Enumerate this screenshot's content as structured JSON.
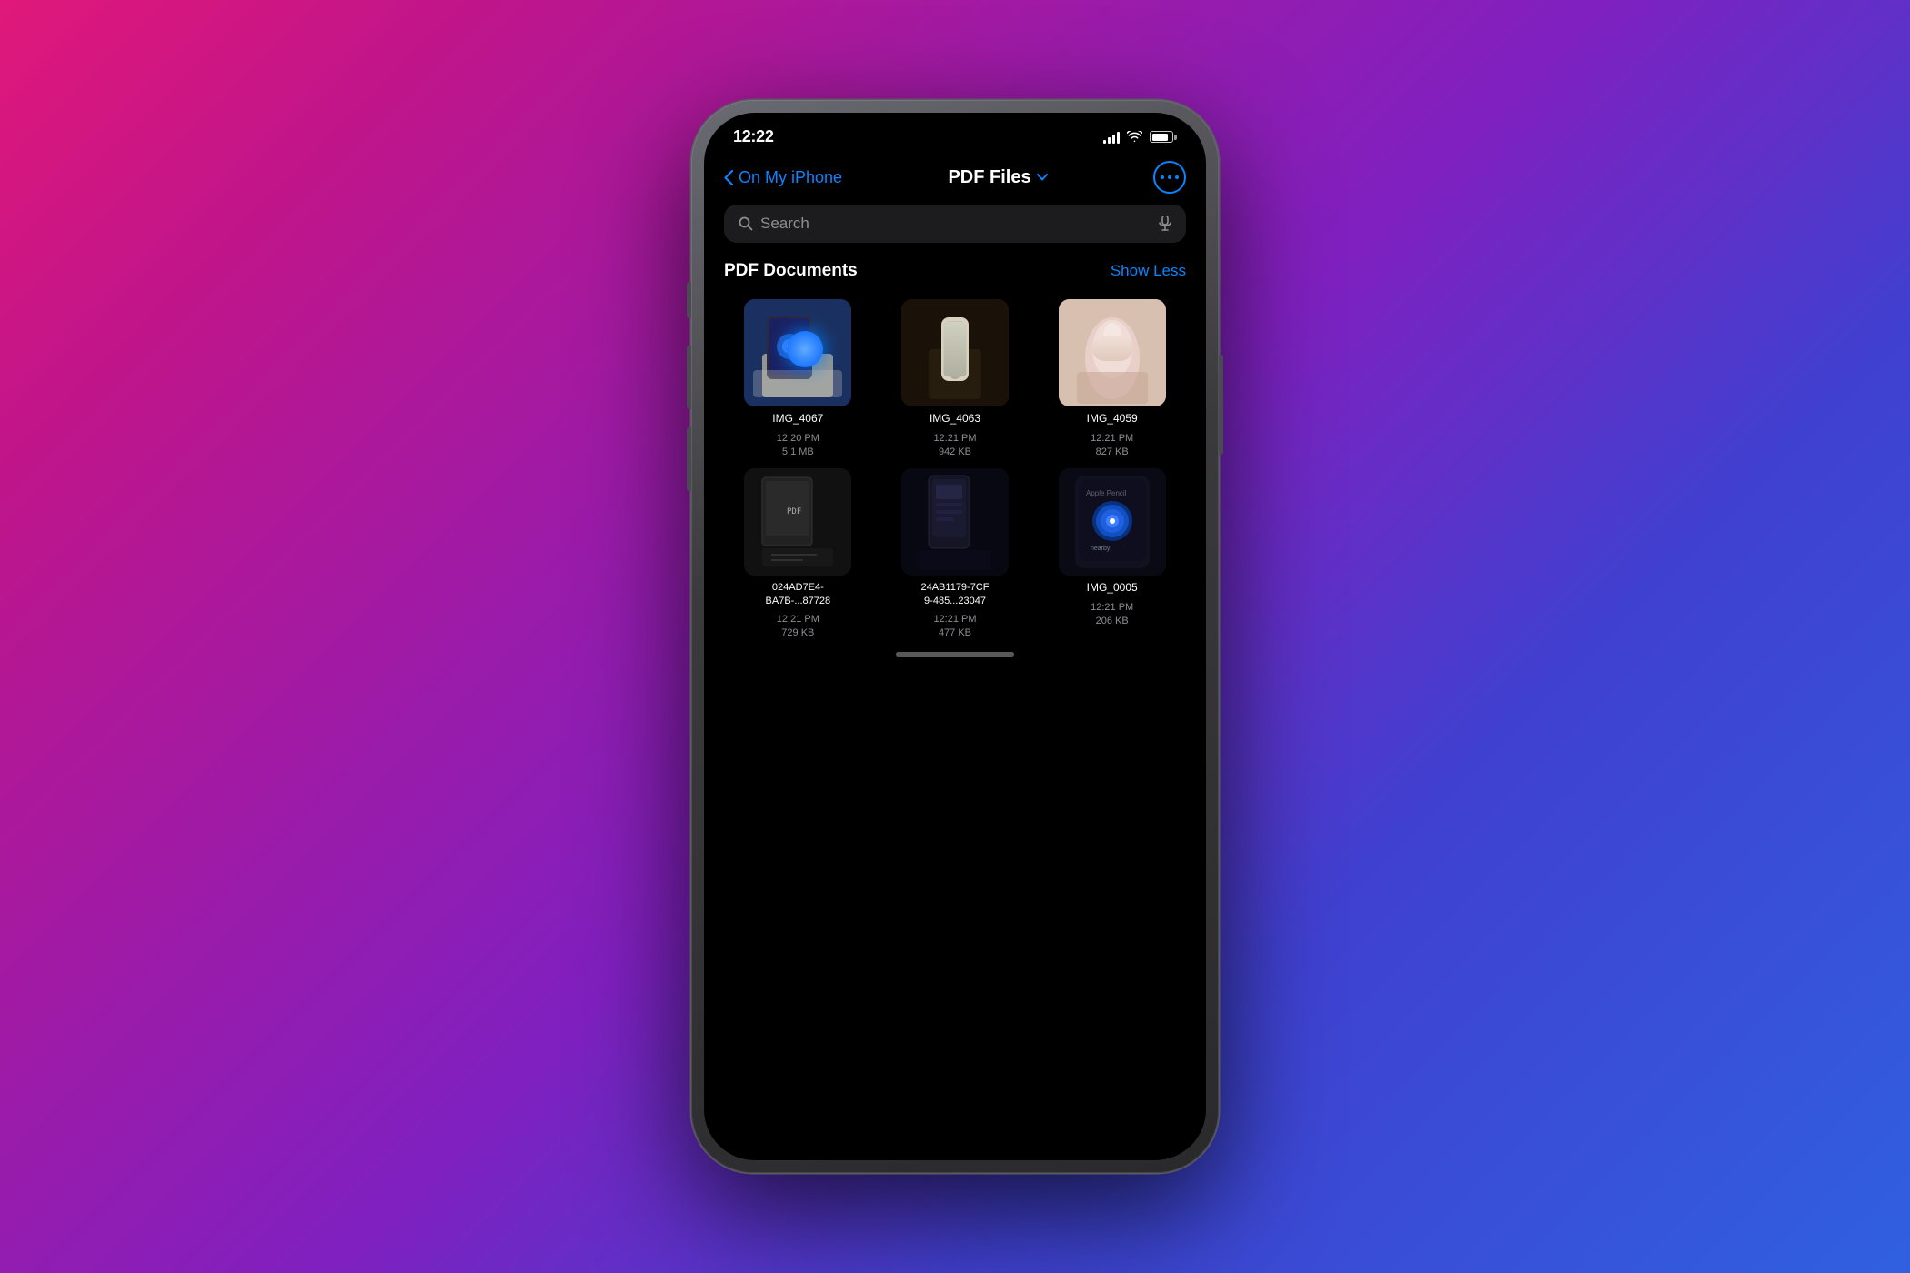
{
  "background": {
    "gradient": "linear-gradient(135deg, #e0187a 0%, #8020c0 50%, #3060e0 100%)"
  },
  "phone": {
    "status_bar": {
      "time": "12:22",
      "signal_label": "signal",
      "wifi_label": "wifi",
      "battery_label": "battery"
    },
    "nav": {
      "back_label": "On My iPhone",
      "title": "PDF Files",
      "chevron": "▾",
      "more_label": "•••"
    },
    "search": {
      "placeholder": "Search",
      "mic_label": "microphone"
    },
    "section": {
      "title": "PDF Documents",
      "show_less": "Show Less"
    },
    "files": [
      {
        "id": "file-1",
        "name": "IMG_4067",
        "time": "12:20 PM",
        "size": "5.1 MB",
        "thumb_class": "thumb-1"
      },
      {
        "id": "file-2",
        "name": "IMG_4063",
        "time": "12:21 PM",
        "size": "942 KB",
        "thumb_class": "thumb-2"
      },
      {
        "id": "file-3",
        "name": "IMG_4059",
        "time": "12:21 PM",
        "size": "827 KB",
        "thumb_class": "thumb-3"
      },
      {
        "id": "file-4",
        "name": "024AD7E4-\nBA7B-...87728",
        "name_line1": "024AD7E4-",
        "name_line2": "BA7B-...87728",
        "time": "12:21 PM",
        "size": "729 KB",
        "thumb_class": "thumb-4"
      },
      {
        "id": "file-5",
        "name": "24AB1179-7CF\n9-485...23047",
        "name_line1": "24AB1179-7CF",
        "name_line2": "9-485...23047",
        "time": "12:21 PM",
        "size": "477 KB",
        "thumb_class": "thumb-5"
      },
      {
        "id": "file-6",
        "name": "IMG_0005",
        "time": "12:21 PM",
        "size": "206 KB",
        "thumb_class": "thumb-6"
      }
    ]
  }
}
